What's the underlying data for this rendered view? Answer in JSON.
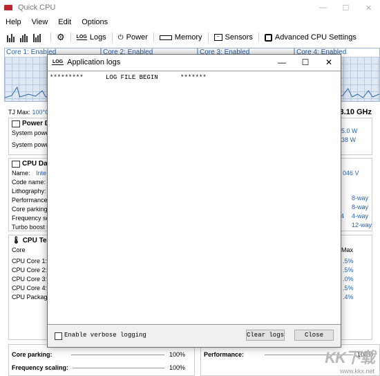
{
  "window": {
    "title": "Quick CPU",
    "controls": [
      "—",
      "☐",
      "✕"
    ]
  },
  "menu": [
    "Help",
    "View",
    "Edit",
    "Options"
  ],
  "toolbar": {
    "buttons": [
      {
        "label": "Logs",
        "icon": "log-icon"
      },
      {
        "label": "Power",
        "icon": "power-icon"
      },
      {
        "label": "Memory",
        "icon": "memory-icon"
      },
      {
        "label": "Sensors",
        "icon": "sensors-icon"
      },
      {
        "label": "Advanced CPU Settings",
        "icon": "cpu-settings-icon"
      }
    ]
  },
  "cores": [
    {
      "label": "Core 1: Enabled"
    },
    {
      "label": "Core 2: Enabled"
    },
    {
      "label": "Core 3: Enabled"
    },
    {
      "label": "Core 4: Enabled"
    }
  ],
  "tj": {
    "label": "TJ Max:",
    "value": "100°C"
  },
  "frequency": "3.10 GHz",
  "power": {
    "title": "Power D",
    "rows": [
      "System power",
      "System power"
    ],
    "values": [
      "5.0 W",
      "38 W"
    ]
  },
  "cpu_data": {
    "title": "CPU Da",
    "rows": [
      "Name:",
      "Code name:",
      "Lithography:",
      "Performance c",
      "Core parking i",
      "Frequency sc",
      "Turbo boost in"
    ],
    "name_value": "Inte",
    "voltage": "046 V",
    "right_values": [
      "8-way",
      "8-way",
      "4-way",
      "12-way"
    ],
    "extra": "4"
  },
  "cpu_temp": {
    "title": "CPU Te",
    "header": "Core",
    "header_right": "Max",
    "rows": [
      "CPU Core 1:",
      "CPU Core 2:",
      "CPU Core 3:",
      "CPU Core 4:",
      "CPU Package"
    ],
    "values": [
      ".5%",
      ".5%",
      ".0%",
      ".5%",
      ".4%"
    ]
  },
  "bottom": {
    "core_parking": {
      "label": "Core parking:",
      "value": "100%"
    },
    "frequency_scaling": {
      "label": "Frequency scaling:",
      "value": "100%"
    },
    "performance": {
      "label": "Performance:",
      "value": "100%"
    }
  },
  "dialog": {
    "title": "Application logs",
    "icon_text": "LOG",
    "log_text": "*********      LOG FILE BEGIN      *******",
    "verbose_label": "Enable verbose logging",
    "clear_label": "Clear logs",
    "close_label": "Close"
  },
  "watermark": {
    "logo": "KK下载",
    "url": "www.kkx.net"
  }
}
